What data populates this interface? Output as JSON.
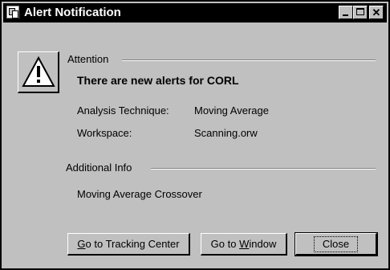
{
  "window": {
    "title": "Alert Notification"
  },
  "alert": {
    "section_label": "Attention",
    "heading": "There are new alerts for CORL",
    "fields": [
      {
        "label": "Analysis Technique:",
        "value": "Moving Average"
      },
      {
        "label": "Workspace:",
        "value": "Scanning.orw"
      }
    ]
  },
  "additional": {
    "section_label": "Additional Info",
    "text": "Moving Average Crossover"
  },
  "buttons": {
    "tracking": {
      "mnemonic": "G",
      "rest": "o to Tracking Center"
    },
    "window": {
      "pre": "Go to ",
      "mnemonic": "W",
      "post": "indow"
    },
    "close": "Close"
  },
  "icons": {
    "app": "app-icon",
    "warning": "warning-icon",
    "minimize": "minimize-icon",
    "maximize": "maximize-icon",
    "close": "close-icon"
  },
  "colors": {
    "titlebar": "#000000",
    "face": "#c0c0c0"
  }
}
